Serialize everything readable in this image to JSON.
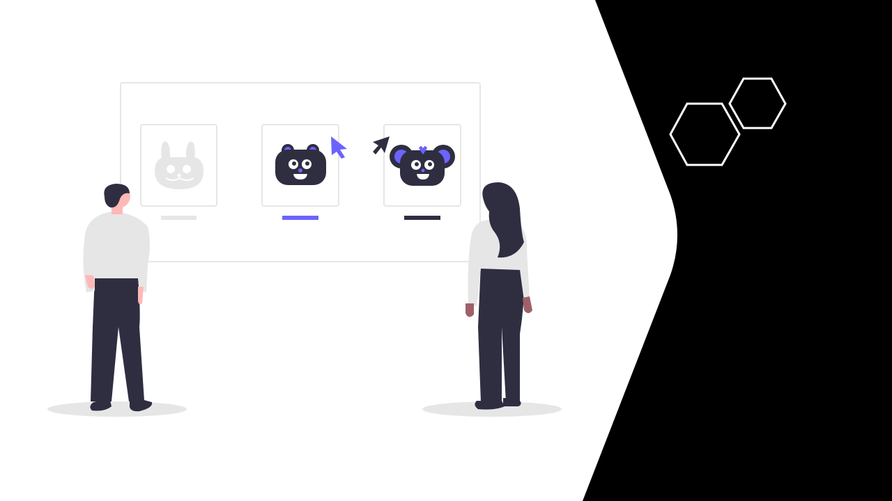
{
  "theme": {
    "background": "#ffffff",
    "right_panel": "#000000",
    "accent": "#6c63ff",
    "dark": "#2f2e41",
    "light_gray": "#e6e6e6",
    "frame_stroke": "#e6e6e6",
    "skin": "#ffb8b8",
    "skin_dark": "#9e616a",
    "hexagon_stroke": "#ffffff"
  },
  "avatar_cards": [
    {
      "icon": "bunny-face-icon",
      "state": "faded",
      "underline": "light"
    },
    {
      "icon": "bear-face-icon",
      "state": "hovered",
      "underline": "accent"
    },
    {
      "icon": "mouse-face-icon",
      "state": "selected",
      "underline": "dark"
    }
  ],
  "cursors": [
    "accent-cursor-icon",
    "dark-cursor-icon"
  ],
  "people": [
    "man-figure",
    "woman-figure"
  ],
  "decorations": [
    "hexagon-outline",
    "hexagon-outline"
  ]
}
